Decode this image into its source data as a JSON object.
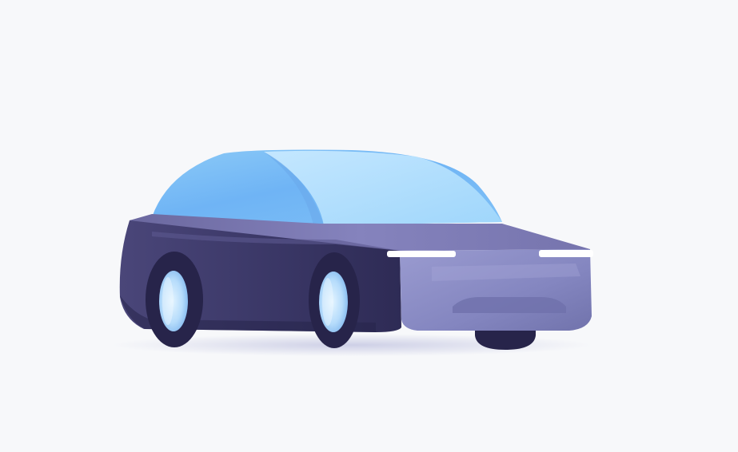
{
  "scene": {
    "subject": "car-illustration",
    "colors": {
      "background": "#f7f8fa",
      "canopy_light": "#c4e7ff",
      "canopy_dark": "#6fb4f5",
      "side_body_dark": "#2e2b55",
      "side_body_light": "#4a4679",
      "front_body": "#8a8bc4",
      "front_body_shade": "#6e6fa9",
      "hood": "#7b79b4",
      "headlight": "#ffffff",
      "wheel": "#27244a",
      "hub_light": "#d6eeff",
      "hub_mid": "#8fc4f2",
      "shadow": "#c9cbe4"
    }
  }
}
